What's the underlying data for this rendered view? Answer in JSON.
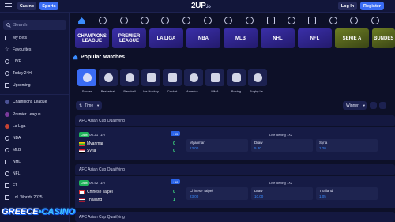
{
  "header": {
    "casino": "Casino",
    "sports": "Sports",
    "logo": "2UP",
    "logo_suffix": ".io",
    "login": "Log In",
    "register": "Register"
  },
  "sidebar": {
    "search": "Search",
    "items": [
      {
        "label": "My Bets",
        "icon": "bets-icon"
      },
      {
        "label": "Favourites",
        "icon": "star-icon"
      },
      {
        "label": "LIVE",
        "icon": "live-icon"
      },
      {
        "label": "Today 24H",
        "icon": "clock-icon"
      },
      {
        "label": "Upcoming",
        "icon": "calendar-icon"
      }
    ],
    "leagues": [
      {
        "label": "Champions League",
        "icon": "trophy-icon"
      },
      {
        "label": "Premier League",
        "icon": "trophy-icon"
      },
      {
        "label": "La Liga",
        "icon": "trophy-icon"
      },
      {
        "label": "NBA",
        "icon": "basketball-icon"
      },
      {
        "label": "MLB",
        "icon": "baseball-icon"
      },
      {
        "label": "NHL",
        "icon": "hockey-icon"
      },
      {
        "label": "NFL",
        "icon": "football-icon"
      },
      {
        "label": "F1",
        "icon": "racing-icon"
      },
      {
        "label": "LoL Worlds 2025",
        "icon": "esports-icon"
      }
    ]
  },
  "banners": [
    "CHAMPIONS LEAGUE",
    "PREMIER LEAGUE",
    "LA LIGA",
    "NBA",
    "MLB",
    "NHL",
    "NFL",
    "SERIE A",
    "BUNDES"
  ],
  "popular": {
    "title": "Popular Matches",
    "sports": [
      "Soccer",
      "Basketball",
      "Baseball",
      "Ice Hockey",
      "Cricket",
      "America...",
      "MMA",
      "Boxing",
      "Rugby Le..."
    ]
  },
  "filters": {
    "time": "Time",
    "winner": "Winner"
  },
  "matches": [
    {
      "competition": "AFC Asian Cup Qualifying",
      "live": "LIVE",
      "time": "06:21",
      "period": "1H",
      "home": "Myanmar",
      "away": "Syria",
      "home_score": "0",
      "away_score": "0",
      "more": "+55",
      "market": "Live Betting 1X2",
      "odds": [
        {
          "n": "Myanmar",
          "v": "13.00"
        },
        {
          "n": "Draw",
          "v": "5.30"
        },
        {
          "n": "Syria",
          "v": "1.20"
        }
      ]
    },
    {
      "competition": "AFC Asian Cup Qualifying",
      "live": "LIVE",
      "time": "06:42",
      "period": "1H",
      "home": "Chinese Taipei",
      "away": "Thailand",
      "home_score": "0",
      "away_score": "1",
      "more": "+50",
      "market": "Live Betting 1X2",
      "odds": [
        {
          "n": "Chinese Taipei",
          "v": "23.00"
        },
        {
          "n": "Draw",
          "v": "10.00"
        },
        {
          "n": "Thailand",
          "v": "1.05"
        }
      ]
    },
    {
      "competition": "AFC Asian Cup Qualifying"
    }
  ],
  "watermark": {
    "a": "GREECE",
    "b": "CASINO"
  },
  "colors": {
    "accent": "#3a6cf4",
    "live": "#1fb45a",
    "bg": "#0d1028"
  }
}
